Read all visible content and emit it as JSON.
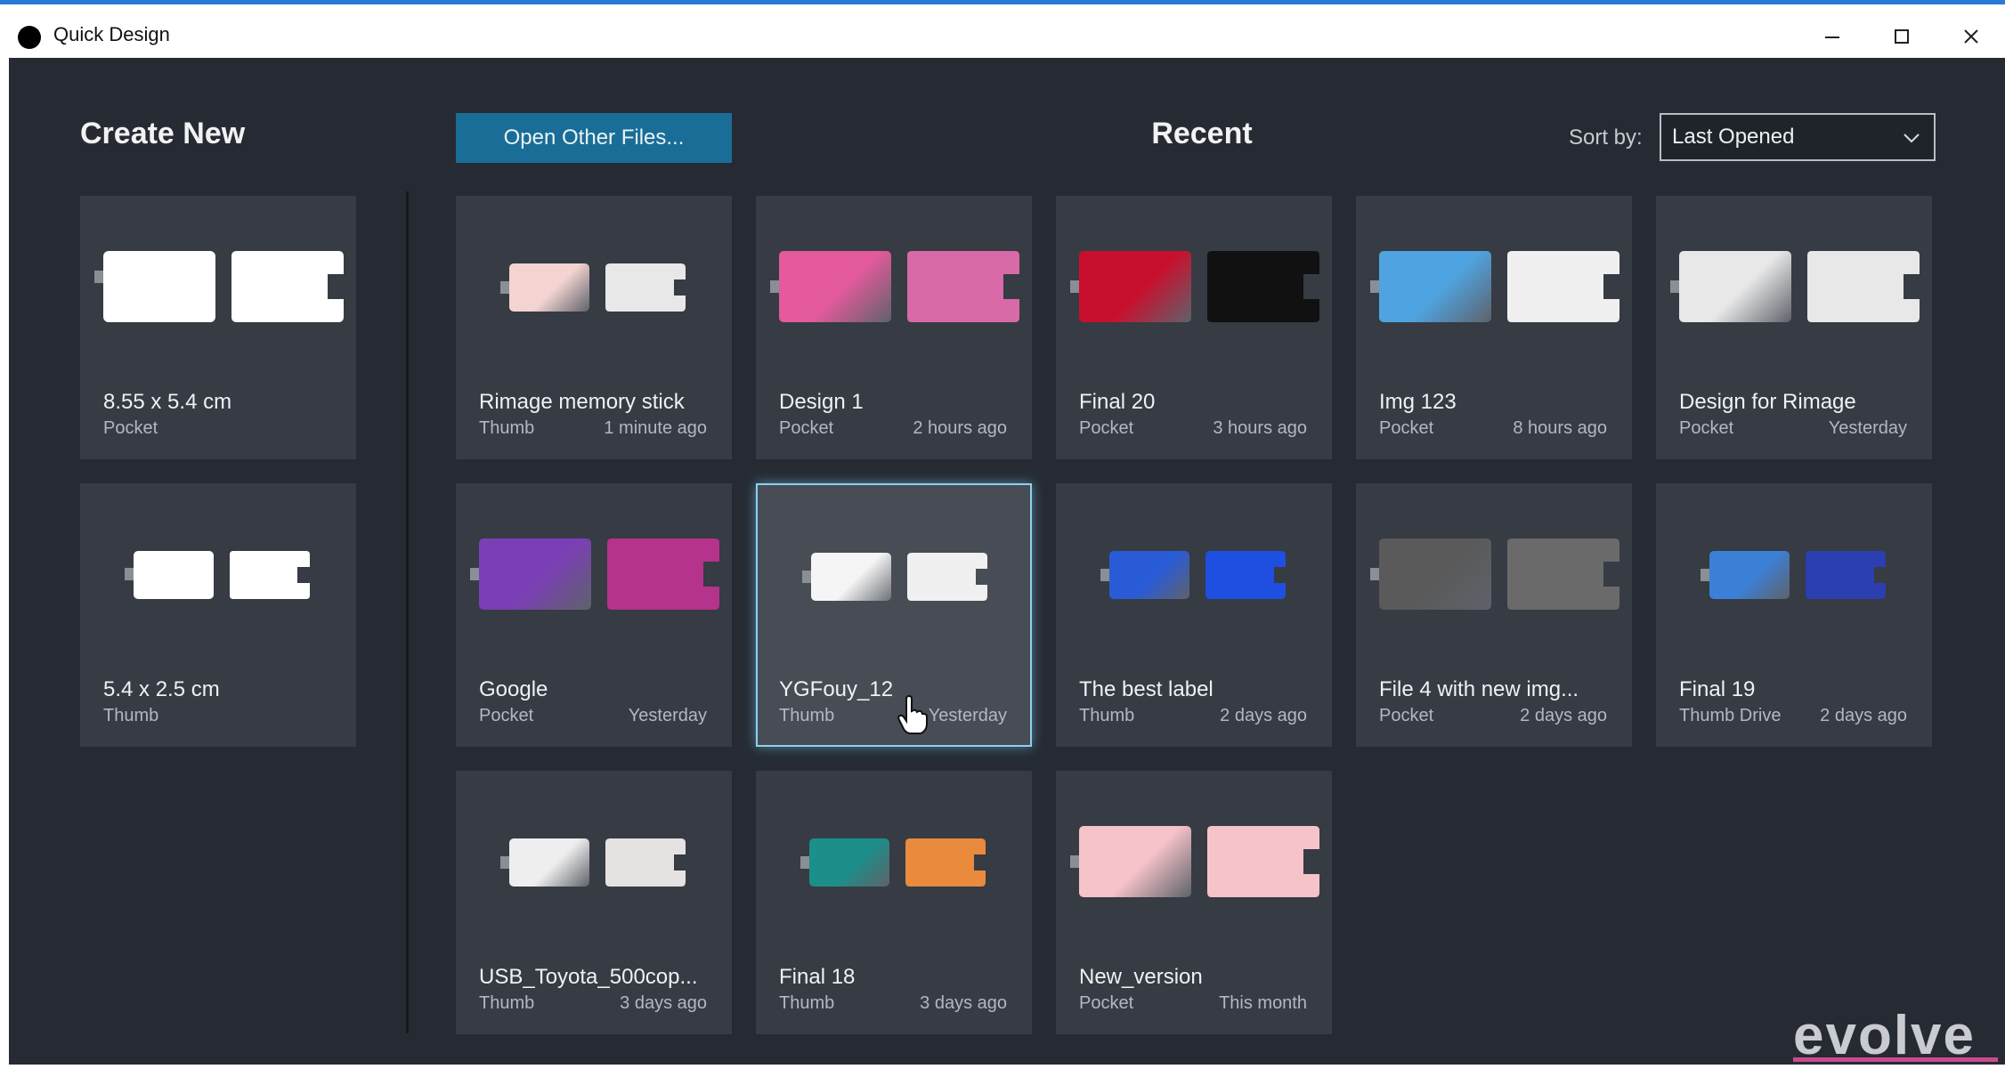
{
  "window": {
    "title": "Quick Design",
    "controls": [
      "minimize",
      "maximize",
      "close"
    ]
  },
  "create_new": {
    "heading": "Create New",
    "templates": [
      {
        "size": "8.55 x 5.4 cm",
        "type": "Pocket"
      },
      {
        "size": "5.4 x 2.5 cm",
        "type": "Thumb"
      }
    ]
  },
  "toolbar": {
    "open_button": "Open Other Files...",
    "recent_heading": "Recent",
    "sort_label": "Sort by:",
    "sort_value": "Last Opened"
  },
  "recent": [
    {
      "name": "Rimage memory stick",
      "type": "Thumb",
      "time": "1 minute ago",
      "colors": [
        "#f3d4d0",
        "#e8e8e8"
      ]
    },
    {
      "name": "Design 1",
      "type": "Pocket",
      "time": "2 hours ago",
      "colors": [
        "#e45a9c",
        "#d96aa8"
      ]
    },
    {
      "name": "Final 20",
      "type": "Pocket",
      "time": "3 hours ago",
      "colors": [
        "#c8102e",
        "#111111"
      ]
    },
    {
      "name": "Img 123",
      "type": "Pocket",
      "time": "8 hours ago",
      "colors": [
        "#4fa3e0",
        "#f0f0f0"
      ]
    },
    {
      "name": "Design for Rimage",
      "type": "Pocket",
      "time": "Yesterday",
      "colors": [
        "#e8e8e8",
        "#e8e8e8"
      ]
    },
    {
      "name": "Google",
      "type": "Pocket",
      "time": "Yesterday",
      "colors": [
        "#7b3fb5",
        "#b5338a"
      ]
    },
    {
      "name": "YGFouy_12",
      "type": "Thumb",
      "time": "Yesterday",
      "colors": [
        "#f5f5f5",
        "#f0f0f0"
      ],
      "selected": true
    },
    {
      "name": "The best label",
      "type": "Thumb",
      "time": "2 days ago",
      "colors": [
        "#2a5bd7",
        "#1f4fe0"
      ]
    },
    {
      "name": "File 4 with new img...",
      "type": "Pocket",
      "time": "2 days ago",
      "colors": [
        "#5a5a5a",
        "#6a6a6a"
      ]
    },
    {
      "name": "Final 19",
      "type": "Thumb Drive",
      "time": "2 days ago",
      "colors": [
        "#3c7fd6",
        "#2b3fb0"
      ]
    },
    {
      "name": "USB_Toyota_500cop...",
      "type": "Thumb",
      "time": "3 days ago",
      "colors": [
        "#eeeeee",
        "#e7e2e2"
      ]
    },
    {
      "name": "Final 18",
      "type": "Thumb",
      "time": "3 days ago",
      "colors": [
        "#1c8f8a",
        "#e98a3c"
      ]
    },
    {
      "name": "New_version",
      "type": "Pocket",
      "time": "This month",
      "colors": [
        "#f6c3c9",
        "#f6c3c9"
      ]
    }
  ],
  "watermark": "evolve"
}
